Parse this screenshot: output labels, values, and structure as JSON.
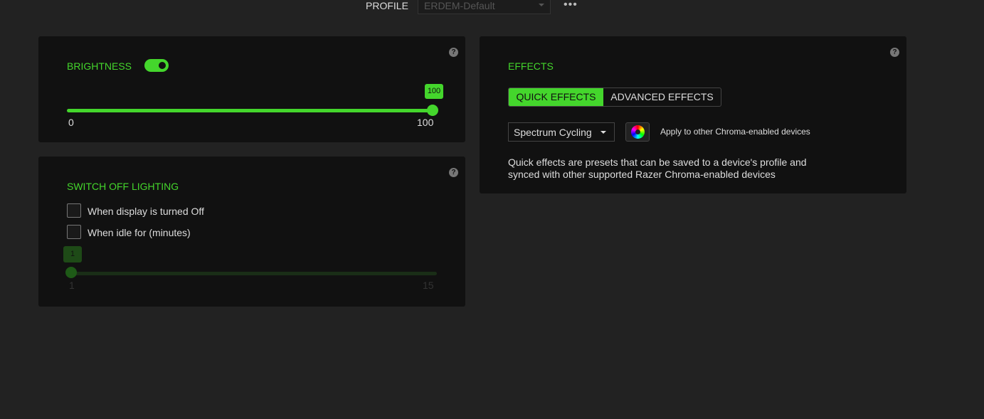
{
  "header": {
    "profile_label": "PROFILE",
    "profile_value": "ERDEM-Default",
    "more_icon": "ellipsis-icon"
  },
  "brightness": {
    "title": "BRIGHTNESS",
    "enabled": true,
    "value": "100",
    "min": "0",
    "max": "100",
    "percent": 100
  },
  "switch_off": {
    "title": "SWITCH OFF LIGHTING",
    "option1": "When display is turned Off",
    "option2": "When idle for (minutes)",
    "option1_checked": false,
    "option2_checked": false,
    "value": "1",
    "min": "1",
    "max": "15"
  },
  "effects": {
    "title": "EFFECTS",
    "tab_quick": "QUICK EFFECTS",
    "tab_advanced": "ADVANCED EFFECTS",
    "selected_effect": "Spectrum Cycling",
    "apply_label": "Apply to other Chroma-enabled devices",
    "description_line1": "Quick effects are presets that can be saved to a device's profile and",
    "description_line2": "synced with other supported Razer Chroma-enabled devices"
  },
  "help": "?",
  "colors": {
    "accent": "#44d62c",
    "panel": "#111111",
    "background": "#222222"
  }
}
